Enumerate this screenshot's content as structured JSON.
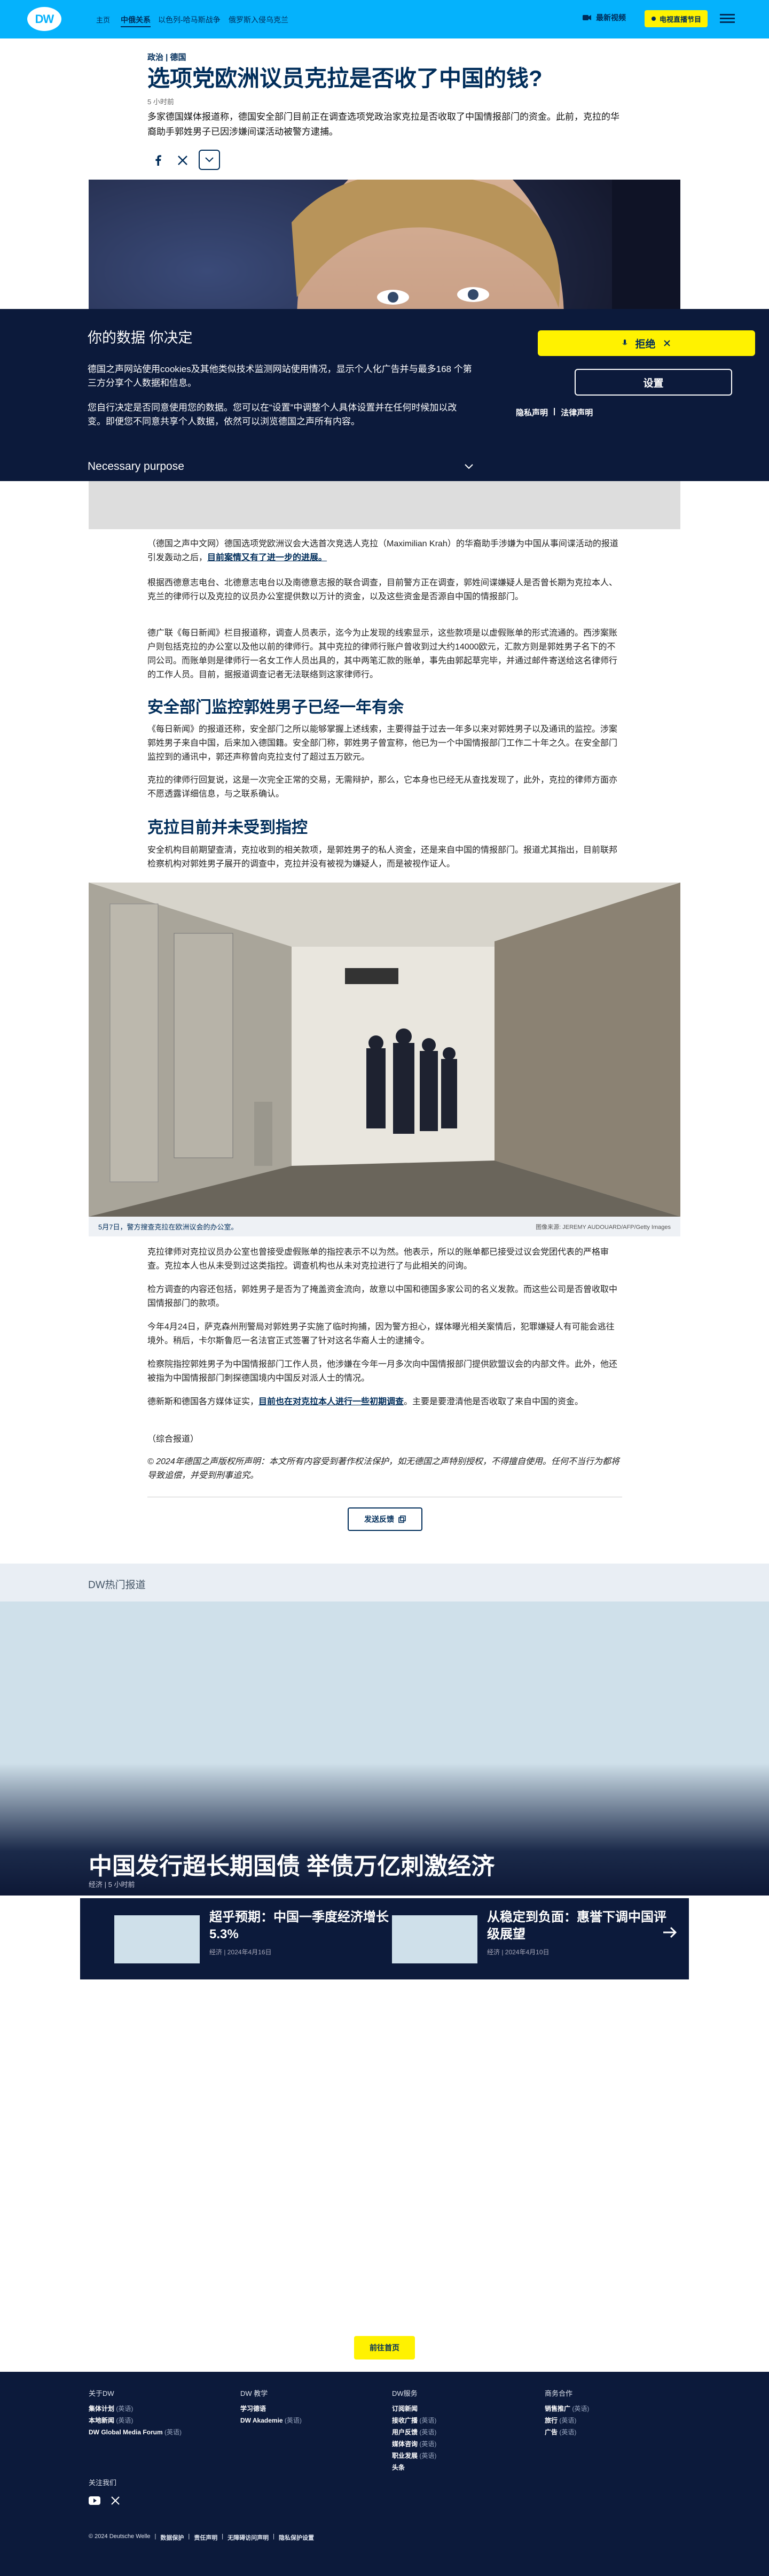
{
  "header": {
    "logo": "DW",
    "nav_home": "主页",
    "nav_items": [
      "中俄关系",
      "以色列-哈马斯战争",
      "俄罗斯入侵乌克兰"
    ],
    "live_label": "最新视频",
    "news_label": "电视直播节目",
    "brand_color": "#05b2fc"
  },
  "article": {
    "kicker": "政治 | 德国",
    "title": "选项党欧洲议员克拉是否收了中国的钱?",
    "time": "5 小时前",
    "lead": "多家德国媒体报道称，德国安全部门目前正在调查选项党政治家克拉是否收取了中国情报部门的资金。此前，克拉的华裔助手郭姓男子已因涉嫌间谍活动被警方逮捕。"
  },
  "cookie": {
    "title": "你的数据 你决定",
    "p1": "德国之声网站使用cookies及其他类似技术监测网站使用情况，显示个人化广告并与最多168 个第三方分享个人数据和信息。",
    "p2": "您自行决定是否同意使用您的数据。您可以在“设置”中调整个人具体设置并在任何时候加以改变。即便您不同意共享个人数据，依然可以浏览德国之声所有内容。",
    "purpose": "Necessary purpose",
    "reject": "拒绝",
    "settings": "设置",
    "privacy": "隐私声明",
    "legal": "法律声明"
  },
  "body": {
    "p1_a": "（德国之声中文网）德国选项党欧洲议会大选首次竞选人克拉（Maximilian Krah）的华裔助手涉嫌为中国从事间谍活动的报道引发轰动之后，",
    "p1_link": "目前案情又有了进一步的进展。",
    "p2": "根据西德意志电台、北德意志电台以及南德意志报的联合调查，目前警方正在调查，郭姓间谍嫌疑人是否曾长期为克拉本人、克兰的律师行以及克拉的议员办公室提供数以万计的资金，以及这些资金是否源自中国的情报部门。",
    "p3": "德广联《每日新闻》栏目报道称，调查人员表示，迄今为止发现的线索显示，这些款项是以虚假账单的形式流通的。西涉案账户则包括克拉的办公室以及他以前的律师行。其中克拉的律师行账户曾收到过大约14000欧元，汇款方则是郭姓男子名下的不同公司。而账单则是律师行一名女工作人员出具的，其中两笔汇款的账单，事先由郭起草完毕，并通过邮件寄送给这名律师行的工作人员。目前，据报道调查记者无法联络到这家律师行。",
    "h2_1": "安全部门监控郭姓男子已经一年有余",
    "p4": "《每日新闻》的报道还称，安全部门之所以能够掌握上述线索，主要得益于过去一年多以来对郭姓男子以及通讯的监控。涉案郭姓男子来自中国，后来加入德国籍。安全部门称，郭姓男子曾宣称，他已为一个中国情报部门工作二十年之久。在安全部门监控到的通讯中，郭还声称曾向克拉支付了超过五万欧元。",
    "p5": "克拉的律师行回复说，这是一次完全正常的交易，无需辩护，那么，它本身也已经无从查找发现了，此外，克拉的律师方面亦不愿透露详细信息，与之联系确认。",
    "h2_2": "克拉目前并未受到指控",
    "p6": "安全机构目前期望查清，克拉收到的相关款项，是郭姓男子的私人资金，还是来自中国的情报部门。报道尤其指出，目前联邦检察机构对郭姓男子展开的调查中，克拉并没有被视为嫌疑人，而是被视作证人。",
    "caption": "5月7日，警方搜查克拉在欧洲议会的办公室。",
    "credit": "图像来源: JEREMY AUDOUARD/AFP/Getty Images",
    "p7": "克拉律师对克拉议员办公室也曾接受虚假账单的指控表示不以为然。他表示，所以的账单都已接受过议会党团代表的严格审查。克拉本人也从未受到过这类指控。调查机构也从未对克拉进行了与此相关的问询。",
    "p8": "检方调查的内容还包括，郭姓男子是否为了掩盖资金流向，故意以中国和德国多家公司的名义发款。而这些公司是否曾收取中国情报部门的款项。",
    "p9": "今年4月24日，萨克森州刑警局对郭姓男子实施了临时拘捕，因为警方担心，媒体曝光相关案情后，犯罪嫌疑人有可能会逃往境外。稍后，卡尔斯鲁厄一名法官正式签署了针对这名华裔人士的逮捕令。",
    "p10": "检察院指控郭姓男子为中国情报部门工作人员，他涉嫌在今年一月多次向中国情报部门提供欧盟议会的内部文件。此外，他还被指为中国情报部门刺探德国境内中国反对派人士的情况。",
    "p11_a": "德新斯和德国各方媒体证实，",
    "p11_link": "目前也在对克拉本人进行一些初期调查",
    "p11_b": "。主要是要澄清他是否收取了来自中国的资金。",
    "p12": "（综合报道）",
    "p13": "© 2024年德国之声版权所声明：本文所有内容受到著作权法保护，如无德国之声特别授权，不得擅自使用。任何不当行为都将导致追偿，并受到刑事追究。",
    "feedback": "发送反馈"
  },
  "hot": {
    "label": "DW热门报道",
    "title": "中国发行超长期国债 举债万亿刺激经济",
    "meta": "经济 | 5 小时前",
    "cards": [
      {
        "title": "超乎预期：中国一季度经济增长5.3%",
        "meta": "经济 | 2024年4月16日"
      },
      {
        "title": "从稳定到负面：惠誉下调中国评级展望",
        "meta": "经济 | 2024年4月10日"
      }
    ]
  },
  "home_button": "前往首页",
  "footer": {
    "cols": [
      {
        "head": "关于DW",
        "items": [
          {
            "t": "集体计划",
            "s": "(英语)"
          },
          {
            "t": "本地新闻",
            "s": "(英语)"
          },
          {
            "t": "DW Global Media Forum",
            "s": "(英语)"
          }
        ]
      },
      {
        "head": "DW 教学",
        "items": [
          {
            "t": "学习德语",
            "s": ""
          },
          {
            "t": "DW Akademie",
            "s": "(英语)"
          }
        ]
      },
      {
        "head": "DW服务",
        "items": [
          {
            "t": "订阅新闻",
            "s": ""
          },
          {
            "t": "接收广播",
            "s": "(英语)"
          },
          {
            "t": "用户反馈",
            "s": "(英语)"
          },
          {
            "t": "媒体咨询",
            "s": "(英语)"
          },
          {
            "t": "职业发展",
            "s": "(英语)"
          },
          {
            "t": "头条",
            "s": ""
          }
        ]
      },
      {
        "head": "商务合作",
        "items": [
          {
            "t": "销售推广",
            "s": "(英语)"
          },
          {
            "t": "旅行",
            "s": "(英语)"
          },
          {
            "t": "广告",
            "s": "(英语)"
          }
        ]
      }
    ],
    "follow": "关注我们",
    "copyright": "© 2024 Deutsche Welle",
    "links": [
      "数据保护",
      "责任声明",
      "无障碍访问声明",
      "隐私保护设置"
    ]
  }
}
